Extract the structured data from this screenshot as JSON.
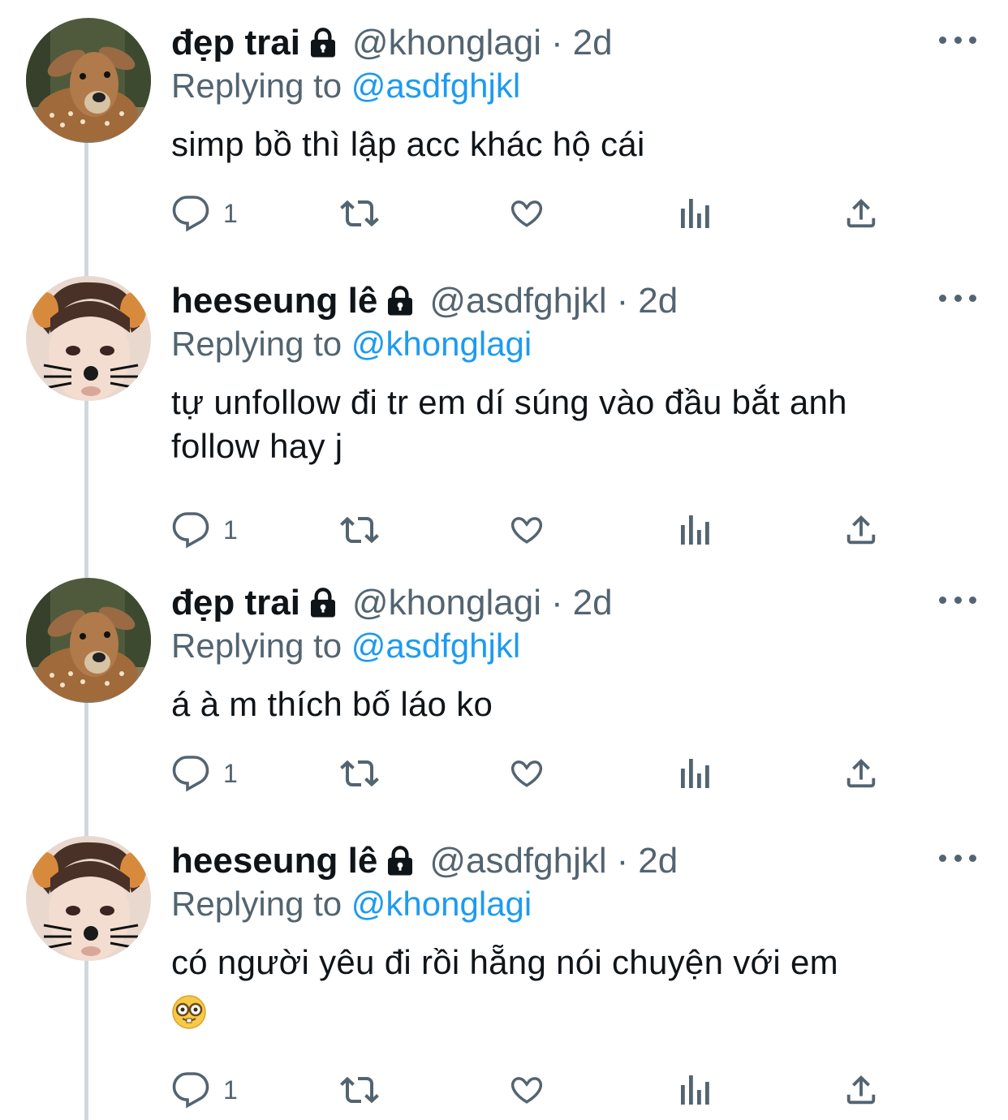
{
  "tweets": [
    {
      "name": "đẹp trai",
      "handle": "@khonglagi",
      "separator": "·",
      "time": "2d",
      "replying_prefix": "Replying to",
      "replying_to": "@asdfghjkl",
      "text_lines": [
        "simp bồ thì lập acc khác hộ cái"
      ],
      "reply_count": "1",
      "avatar": "deer-avatar"
    },
    {
      "name": "heeseung lê",
      "handle": "@asdfghjkl",
      "separator": "·",
      "time": "2d",
      "replying_prefix": "Replying to",
      "replying_to": "@khonglagi",
      "text_lines": [
        "tự unfollow đi tr em dí súng vào đầu bắt anh",
        "follow hay j"
      ],
      "reply_count": "1",
      "avatar": "person-cat-filter-avatar"
    },
    {
      "name": "đẹp trai",
      "handle": "@khonglagi",
      "separator": "·",
      "time": "2d",
      "replying_prefix": "Replying to",
      "replying_to": "@asdfghjkl",
      "text_lines": [
        "á à m thích bố láo ko"
      ],
      "reply_count": "1",
      "avatar": "deer-avatar"
    },
    {
      "name": "heeseung lê",
      "handle": "@asdfghjkl",
      "separator": "·",
      "time": "2d",
      "replying_prefix": "Replying to",
      "replying_to": "@khonglagi",
      "text_lines": [
        "có người yêu đi rồi hẵng nói chuyện với em"
      ],
      "emoji": "nerd-face-emoji",
      "reply_count": "1",
      "avatar": "person-cat-filter-avatar"
    }
  ],
  "icons": {
    "lock": "lock-icon",
    "more": "more-icon",
    "reply": "reply-icon",
    "retweet": "retweet-icon",
    "like": "heart-icon",
    "views": "analytics-icon",
    "share": "share-icon"
  },
  "colors": {
    "text": "#0f1419",
    "secondary": "#536471",
    "link": "#1d9bf0",
    "thread_line": "#cfd9de"
  }
}
